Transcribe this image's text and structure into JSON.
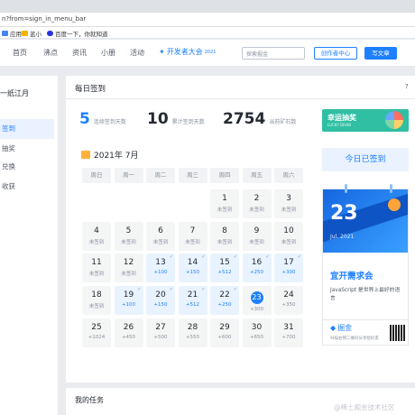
{
  "browser": {
    "url": "n?from=sign_in_menu_bar",
    "bookmarks": [
      "应用",
      "蓝小",
      "百度一下，你就知道"
    ]
  },
  "nav": {
    "items": [
      "首页",
      "沸点",
      "资讯",
      "小册",
      "活动"
    ],
    "logo": "开发者大会",
    "logo_year": "2021",
    "search_placeholder": "探索掘金",
    "creator": "创作者中心",
    "write": "写文章"
  },
  "sidebar": {
    "user": "一纸江月",
    "items": [
      "签到",
      "抽奖",
      "兑换",
      "收获"
    ]
  },
  "main": {
    "title": "每日签到",
    "help": "?",
    "stats": [
      {
        "value": "5",
        "label": "连续签到天数"
      },
      {
        "value": "10",
        "label": "累计签到天数"
      },
      {
        "value": "2754",
        "label": "当前矿石数"
      }
    ],
    "month": "2021年 7月",
    "weekdays": [
      "周日",
      "周一",
      "周二",
      "周三",
      "周四",
      "周五",
      "周六"
    ],
    "days": [
      {
        "d": "1",
        "s": "未签到",
        "state": "none"
      },
      {
        "d": "2",
        "s": "未签到",
        "state": "none"
      },
      {
        "d": "3",
        "s": "未签到",
        "state": "none"
      },
      {
        "d": "4",
        "s": "未签到",
        "state": "none"
      },
      {
        "d": "5",
        "s": "未签到",
        "state": "none"
      },
      {
        "d": "6",
        "s": "未签到",
        "state": "none"
      },
      {
        "d": "7",
        "s": "未签到",
        "state": "none"
      },
      {
        "d": "8",
        "s": "未签到",
        "state": "none"
      },
      {
        "d": "9",
        "s": "未签到",
        "state": "none"
      },
      {
        "d": "10",
        "s": "未签到",
        "state": "none"
      },
      {
        "d": "11",
        "s": "未签到",
        "state": "none"
      },
      {
        "d": "12",
        "s": "未签到",
        "state": "none"
      },
      {
        "d": "13",
        "s": "+100",
        "state": "signed"
      },
      {
        "d": "14",
        "s": "+150",
        "state": "signed"
      },
      {
        "d": "15",
        "s": "+512",
        "state": "signed"
      },
      {
        "d": "16",
        "s": "+250",
        "state": "signed"
      },
      {
        "d": "17",
        "s": "+300",
        "state": "signed"
      },
      {
        "d": "18",
        "s": "未签到",
        "state": "none"
      },
      {
        "d": "19",
        "s": "+100",
        "state": "signed"
      },
      {
        "d": "20",
        "s": "+150",
        "state": "signed"
      },
      {
        "d": "21",
        "s": "+512",
        "state": "signed"
      },
      {
        "d": "22",
        "s": "+250",
        "state": "signed"
      },
      {
        "d": "23",
        "s": "+300",
        "state": "today"
      },
      {
        "d": "24",
        "s": "+350",
        "state": "future"
      },
      {
        "d": "25",
        "s": "+1024",
        "state": "future"
      },
      {
        "d": "26",
        "s": "+450",
        "state": "future"
      },
      {
        "d": "27",
        "s": "+500",
        "state": "future"
      },
      {
        "d": "28",
        "s": "+550",
        "state": "future"
      },
      {
        "d": "29",
        "s": "+600",
        "state": "future"
      },
      {
        "d": "30",
        "s": "+650",
        "state": "future"
      },
      {
        "d": "31",
        "s": "+700",
        "state": "future"
      }
    ]
  },
  "right": {
    "lucky_title": "幸运抽奖",
    "lucky_sub": "LUCKY DRAW",
    "signed_button": "今日已签到",
    "card_day": "23",
    "card_month": "Jul. 2021",
    "card_title": "宜开需求会",
    "card_text": "JavaScript 是世界上最好的语言",
    "brand": "掘金",
    "brand_sub": "扫描右侧二维码分享给好友"
  },
  "tasks": {
    "title": "我的任务"
  },
  "watermark": "@稀土掘金技术社区"
}
